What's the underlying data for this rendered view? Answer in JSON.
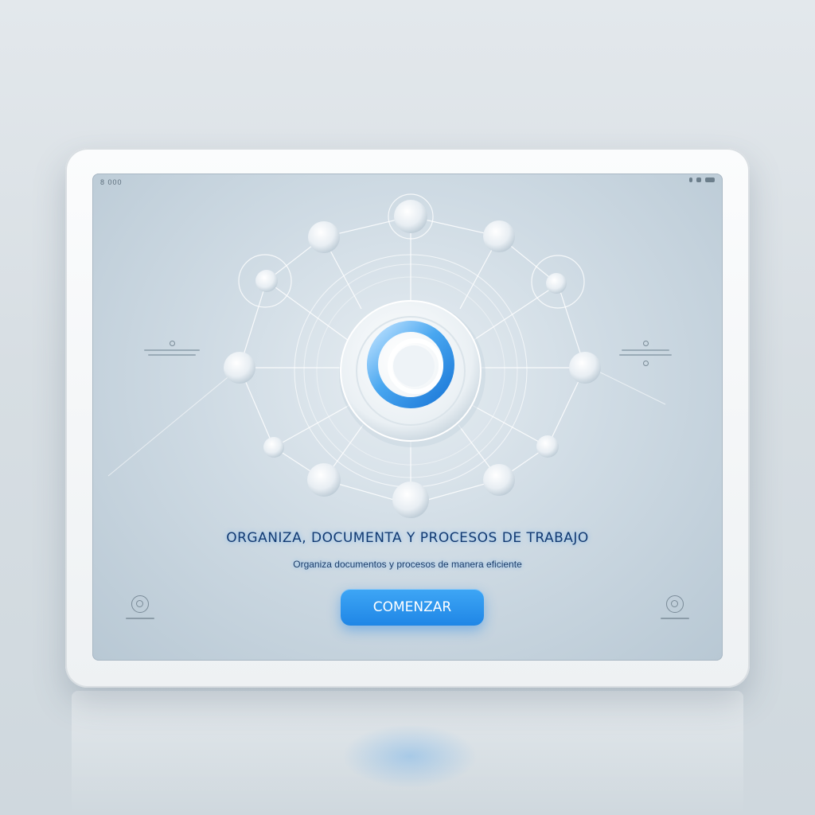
{
  "device": {
    "status_left": "8 000",
    "status_right_icons": [
      "signal-icon",
      "wifi-icon",
      "battery-icon"
    ]
  },
  "graphic": {
    "central_logo": "ring-logo-icon",
    "accent_color": "#2a8fe8",
    "node_color": "#eef3f7"
  },
  "content": {
    "headline": "ORGANIZA, DOCUMENTA Y PROCESOS DE TRABAJO",
    "subline": "Organiza documentos y procesos de manera eficiente",
    "cta_label": "COMENZAR",
    "cta_color": "#1f86e6"
  },
  "side_panels": {
    "left_icon": "info-dot-icon",
    "right_icon": "info-dot-icon"
  },
  "corner_buttons": {
    "left_icon": "target-icon",
    "right_icon": "target-icon"
  }
}
